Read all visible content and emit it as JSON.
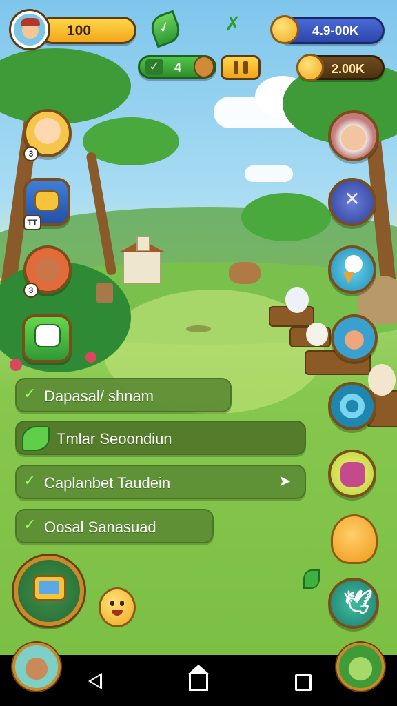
{
  "hud": {
    "coins": "100",
    "gems": "4.9-00K",
    "gold": "2.00K",
    "tickets": "4"
  },
  "quests": [
    {
      "label": "Dapasal/ shnam",
      "checked": true
    },
    {
      "label": "Tmlar Seoondiun",
      "checked": false
    },
    {
      "label": "Caplanbet Taudein",
      "checked": true
    },
    {
      "label": "Oosal Sanasuad",
      "checked": true
    }
  ],
  "left_badges": [
    "3",
    "TT",
    "0",
    "3"
  ],
  "colors": {
    "coin": "#f2a81c",
    "gem": "#2d46a8",
    "quest_bg": "#5c8c34",
    "frame": "#7a4e18"
  },
  "icons": {
    "leaf": "leaf-icon",
    "pause": "pause-icon",
    "chat": "chat-icon",
    "twitter": "bird-icon",
    "back": "back-icon",
    "home": "home-icon",
    "recents": "recents-icon"
  }
}
